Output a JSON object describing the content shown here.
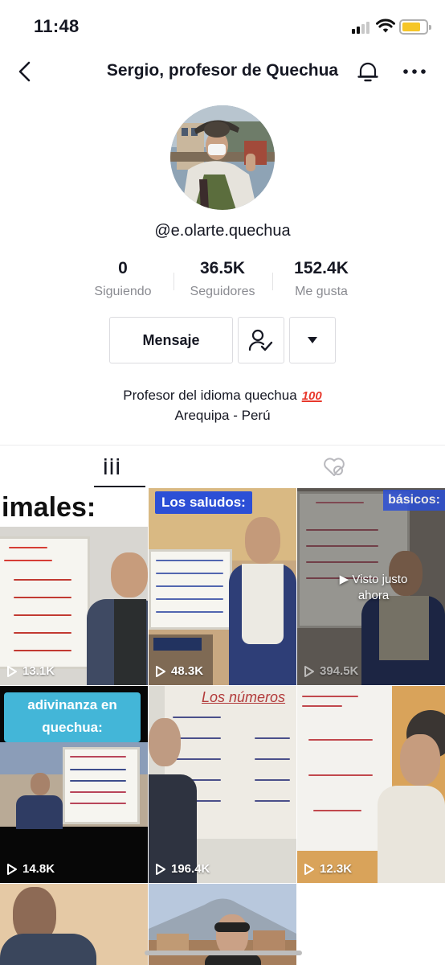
{
  "status": {
    "time": "11:48"
  },
  "header": {
    "title": "Sergio, profesor de Quechua"
  },
  "profile": {
    "username": "@e.olarte.quechua",
    "stats": [
      {
        "value": "0",
        "label": "Siguiendo"
      },
      {
        "value": "36.5K",
        "label": "Seguidores"
      },
      {
        "value": "152.4K",
        "label": "Me gusta"
      }
    ],
    "message_label": "Mensaje",
    "bio_line1": "Profesor del idioma quechua",
    "bio_emoji": "100",
    "bio_line2": "Arequipa - Perú"
  },
  "videos": [
    {
      "caption": "imales:",
      "views": "13.1K"
    },
    {
      "caption": "Los saludos:",
      "views": "48.3K"
    },
    {
      "caption": "básicos:",
      "views": "394.5K",
      "overlay": "▶ Visto justo ahora"
    },
    {
      "caption_line1": "adivinanza en",
      "caption_line2": "quechua:",
      "views": "14.8K"
    },
    {
      "caption": "Los números",
      "views": "196.4K"
    },
    {
      "caption": "",
      "views": "12.3K"
    },
    {
      "caption": "",
      "views": ""
    },
    {
      "caption": "",
      "views": ""
    }
  ],
  "colors": {
    "accent_red": "#e8382c",
    "caption_blue": "#2c4fd6",
    "text": "#161823"
  },
  "icons": [
    "back-chevron-icon",
    "bell-icon",
    "more-dots-icon",
    "follow-check-icon",
    "dropdown-triangle-icon",
    "grid-tab-icon",
    "liked-hidden-icon",
    "play-icon"
  ]
}
